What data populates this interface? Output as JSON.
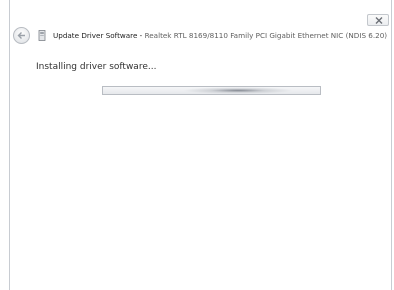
{
  "window": {
    "title": "Update Driver Software - ",
    "device_name": "Realtek RTL 8169/8110 Family PCI Gigabit Ethernet NIC (NDIS 6.20)"
  },
  "main": {
    "status_text": "Installing driver software..."
  },
  "progress": {
    "mode": "indeterminate"
  },
  "icons": {
    "back": "back-arrow-icon",
    "device": "network-adapter-icon",
    "close": "close-icon"
  },
  "colors": {
    "border": "#c8ccd2",
    "text": "#323232"
  }
}
